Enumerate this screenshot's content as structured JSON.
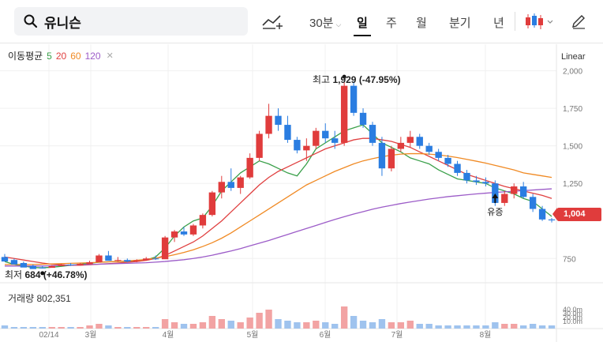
{
  "search": {
    "query": "유니슨"
  },
  "toolbar": {
    "interval": "30분",
    "periods": [
      "일",
      "주",
      "월",
      "분기",
      "년"
    ],
    "active_period": "일"
  },
  "legend": {
    "label": "이동평균",
    "ma": [
      {
        "label": "5",
        "color": "#3aa04a"
      },
      {
        "label": "20",
        "color": "#e04040"
      },
      {
        "label": "60",
        "color": "#f08a24"
      },
      {
        "label": "120",
        "color": "#9c5cc8"
      }
    ]
  },
  "scale": "Linear",
  "annotations": {
    "high_prefix": "최고",
    "high_value": "1,929",
    "high_change": "(-47.95%)",
    "low_prefix": "최저",
    "low_value": "684",
    "low_change": "(+46.78%)",
    "event_label": "유증",
    "current_price": "1,004"
  },
  "volume": {
    "label": "거래량",
    "value": "802,351",
    "ticks": [
      "40.0m",
      "30.0m",
      "20.0m",
      "10.0m"
    ]
  },
  "colors": {
    "up": "#e03c3c",
    "down": "#2a7de1"
  },
  "chart_data": {
    "type": "candlestick",
    "x_ticks": [
      "02/14",
      "3월",
      "4월",
      "5월",
      "6월",
      "7월",
      "8월"
    ],
    "y_ticks": [
      "2,000",
      "1,750",
      "1,500",
      "1,250",
      "750"
    ],
    "ylim": [
      620,
      2040
    ],
    "series_mas": [
      {
        "name": "5",
        "values": [
          730,
          710,
          700,
          690,
          688,
          692,
          698,
          705,
          712,
          718,
          725,
          728,
          730,
          732,
          735,
          740,
          760,
          820,
          900,
          960,
          1000,
          1020,
          1100,
          1200,
          1260,
          1320,
          1360,
          1400,
          1380,
          1350,
          1320,
          1300,
          1380,
          1480,
          1520,
          1560,
          1600,
          1620,
          1640,
          1580,
          1520,
          1490,
          1460,
          1420,
          1400,
          1380,
          1340,
          1310,
          1280,
          1270,
          1260,
          1250,
          1220,
          1200,
          1180,
          1150,
          1130,
          1080,
          1030
        ]
      },
      {
        "name": "20",
        "values": [
          760,
          750,
          740,
          730,
          720,
          712,
          708,
          705,
          705,
          708,
          712,
          716,
          720,
          725,
          730,
          738,
          750,
          770,
          800,
          830,
          860,
          900,
          950,
          1000,
          1060,
          1120,
          1180,
          1240,
          1290,
          1330,
          1360,
          1390,
          1420,
          1450,
          1480,
          1500,
          1520,
          1540,
          1550,
          1550,
          1540,
          1530,
          1510,
          1490,
          1460,
          1430,
          1400,
          1370,
          1340,
          1310,
          1290,
          1270,
          1250,
          1230,
          1215,
          1200,
          1185,
          1170,
          1150
        ]
      },
      {
        "name": "60",
        "values": [
          710,
          710,
          710,
          710,
          712,
          714,
          716,
          718,
          720,
          722,
          725,
          728,
          730,
          734,
          738,
          744,
          752,
          762,
          775,
          790,
          808,
          830,
          855,
          885,
          920,
          960,
          1000,
          1040,
          1080,
          1120,
          1160,
          1200,
          1240,
          1270,
          1300,
          1330,
          1355,
          1380,
          1400,
          1415,
          1428,
          1438,
          1445,
          1448,
          1448,
          1445,
          1440,
          1432,
          1422,
          1410,
          1398,
          1385,
          1370,
          1355,
          1340,
          1320,
          1310,
          1300,
          1290
        ]
      },
      {
        "name": "120",
        "values": [
          700,
          700,
          700,
          700,
          700,
          702,
          704,
          706,
          708,
          710,
          712,
          714,
          716,
          718,
          720,
          722,
          726,
          730,
          736,
          742,
          750,
          760,
          772,
          786,
          800,
          816,
          834,
          852,
          870,
          890,
          910,
          930,
          950,
          970,
          990,
          1010,
          1028,
          1046,
          1062,
          1078,
          1092,
          1104,
          1116,
          1126,
          1136,
          1146,
          1154,
          1162,
          1168,
          1174,
          1180,
          1185,
          1190,
          1194,
          1198,
          1202,
          1206,
          1210,
          1214
        ]
      }
    ],
    "candles": [
      [
        760,
        780,
        740,
        730
      ],
      [
        740,
        750,
        725,
        710
      ],
      [
        720,
        730,
        700,
        690
      ],
      [
        700,
        710,
        690,
        680
      ],
      [
        690,
        700,
        684,
        684
      ],
      [
        688,
        705,
        690,
        700
      ],
      [
        700,
        715,
        705,
        710
      ],
      [
        710,
        720,
        700,
        705
      ],
      [
        705,
        720,
        710,
        715
      ],
      [
        712,
        735,
        718,
        725
      ],
      [
        725,
        780,
        730,
        770
      ],
      [
        770,
        800,
        740,
        735
      ],
      [
        735,
        760,
        728,
        740
      ],
      [
        740,
        750,
        725,
        730
      ],
      [
        730,
        745,
        725,
        738
      ],
      [
        738,
        760,
        735,
        750
      ],
      [
        750,
        770,
        740,
        745
      ],
      [
        745,
        900,
        750,
        890
      ],
      [
        890,
        940,
        860,
        930
      ],
      [
        930,
        960,
        900,
        910
      ],
      [
        910,
        980,
        900,
        970
      ],
      [
        970,
        1050,
        950,
        1040
      ],
      [
        1040,
        1200,
        1030,
        1190
      ],
      [
        1190,
        1300,
        1150,
        1260
      ],
      [
        1260,
        1350,
        1200,
        1220
      ],
      [
        1220,
        1300,
        1180,
        1290
      ],
      [
        1290,
        1450,
        1280,
        1420
      ],
      [
        1420,
        1600,
        1400,
        1580
      ],
      [
        1580,
        1780,
        1550,
        1700
      ],
      [
        1700,
        1750,
        1600,
        1640
      ],
      [
        1640,
        1700,
        1520,
        1540
      ],
      [
        1540,
        1560,
        1450,
        1470
      ],
      [
        1470,
        1550,
        1400,
        1500
      ],
      [
        1500,
        1620,
        1480,
        1600
      ],
      [
        1600,
        1650,
        1520,
        1550
      ],
      [
        1550,
        1600,
        1480,
        1520
      ],
      [
        1520,
        1929,
        1500,
        1900
      ],
      [
        1900,
        1929,
        1700,
        1720
      ],
      [
        1720,
        1750,
        1620,
        1640
      ],
      [
        1640,
        1660,
        1500,
        1520
      ],
      [
        1520,
        1560,
        1300,
        1350
      ],
      [
        1350,
        1500,
        1330,
        1480
      ],
      [
        1480,
        1560,
        1460,
        1520
      ],
      [
        1520,
        1600,
        1490,
        1560
      ],
      [
        1560,
        1580,
        1480,
        1500
      ],
      [
        1500,
        1520,
        1440,
        1460
      ],
      [
        1460,
        1480,
        1400,
        1420
      ],
      [
        1420,
        1440,
        1360,
        1380
      ],
      [
        1380,
        1400,
        1300,
        1320
      ],
      [
        1320,
        1340,
        1250,
        1270
      ],
      [
        1270,
        1300,
        1240,
        1260
      ],
      [
        1260,
        1290,
        1230,
        1250
      ],
      [
        1250,
        1270,
        1100,
        1120
      ],
      [
        1120,
        1200,
        1100,
        1180
      ],
      [
        1180,
        1250,
        1150,
        1230
      ],
      [
        1230,
        1260,
        1150,
        1160
      ],
      [
        1160,
        1180,
        1060,
        1080
      ],
      [
        1080,
        1100,
        1000,
        1010
      ],
      [
        1010,
        1020,
        990,
        1004
      ]
    ],
    "volumes": [
      2,
      1,
      1,
      1,
      1,
      1,
      1,
      1,
      1,
      2,
      3,
      2,
      1,
      1,
      1,
      1,
      1,
      6,
      4,
      3,
      3,
      4,
      8,
      6,
      5,
      4,
      7,
      10,
      12,
      6,
      5,
      4,
      4,
      5,
      4,
      3,
      14,
      8,
      5,
      4,
      6,
      4,
      4,
      5,
      3,
      3,
      2,
      2,
      2,
      2,
      2,
      2,
      4,
      3,
      3,
      2,
      3,
      2,
      2
    ]
  }
}
